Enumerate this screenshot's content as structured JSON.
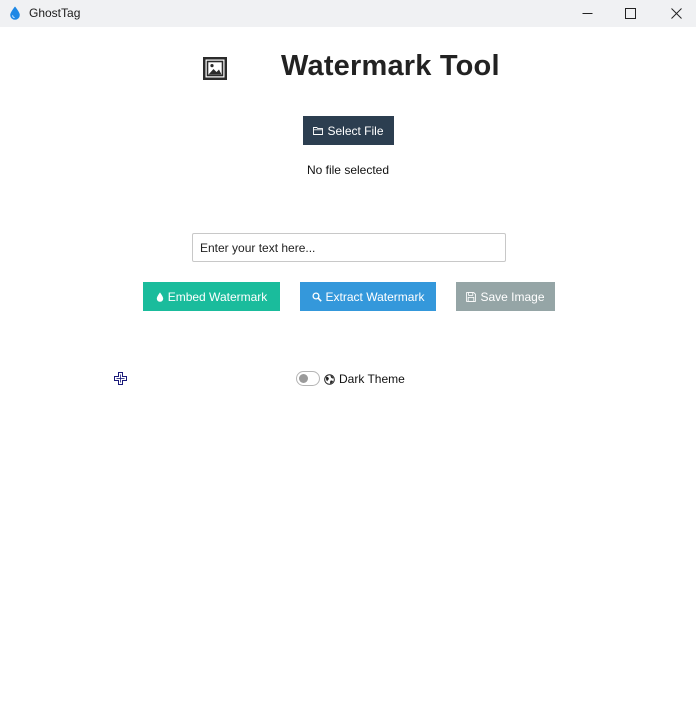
{
  "window": {
    "title": "GhostTag",
    "icon": "water-drop-icon"
  },
  "header": {
    "icon": "framed-picture-icon",
    "title": "Watermark Tool"
  },
  "file": {
    "select_label": "Select File",
    "select_icon": "folder-icon",
    "status": "No file selected"
  },
  "watermark_input": {
    "value": "",
    "placeholder": "Enter your text here..."
  },
  "actions": {
    "embed": {
      "label": "Embed Watermark",
      "icon": "water-drop-icon",
      "color": "#1abc9c"
    },
    "extract": {
      "label": "Extract Watermark",
      "icon": "magnifier-icon",
      "color": "#3498db"
    },
    "save": {
      "label": "Save Image",
      "icon": "floppy-disk-icon",
      "color": "#95a5a6"
    }
  },
  "theme": {
    "label": "Dark Theme",
    "icon": "globe-icon",
    "enabled": false
  },
  "colors": {
    "primary_dark": "#2c3e50",
    "titlebar": "#f0f1f3"
  }
}
